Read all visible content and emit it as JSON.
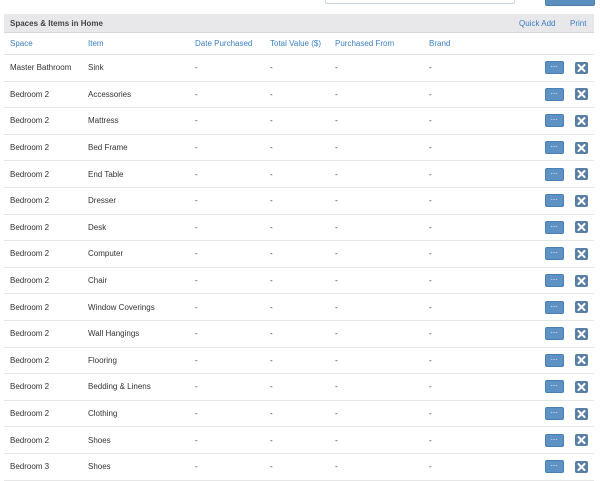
{
  "panel": {
    "title": "Spaces & Items in Home",
    "quick_add": "Quick Add",
    "print": "Print"
  },
  "columns": [
    "Space",
    "Item",
    "Date Purchased",
    "Total Value ($)",
    "Purchased From",
    "Brand"
  ],
  "rows": [
    {
      "space": "Master Bathroom",
      "item": "Sink",
      "date": "-",
      "value": "-",
      "from": "-",
      "brand": "-"
    },
    {
      "space": "Bedroom 2",
      "item": "Accessories",
      "date": "-",
      "value": "-",
      "from": "-",
      "brand": "-"
    },
    {
      "space": "Bedroom 2",
      "item": "Mattress",
      "date": "-",
      "value": "-",
      "from": "-",
      "brand": "-"
    },
    {
      "space": "Bedroom 2",
      "item": "Bed Frame",
      "date": "-",
      "value": "-",
      "from": "-",
      "brand": "-"
    },
    {
      "space": "Bedroom 2",
      "item": "End Table",
      "date": "-",
      "value": "-",
      "from": "-",
      "brand": "-"
    },
    {
      "space": "Bedroom 2",
      "item": "Dresser",
      "date": "-",
      "value": "-",
      "from": "-",
      "brand": "-"
    },
    {
      "space": "Bedroom 2",
      "item": "Desk",
      "date": "-",
      "value": "-",
      "from": "-",
      "brand": "-"
    },
    {
      "space": "Bedroom 2",
      "item": "Computer",
      "date": "-",
      "value": "-",
      "from": "-",
      "brand": "-"
    },
    {
      "space": "Bedroom 2",
      "item": "Chair",
      "date": "-",
      "value": "-",
      "from": "-",
      "brand": "-"
    },
    {
      "space": "Bedroom 2",
      "item": "Window Coverings",
      "date": "-",
      "value": "-",
      "from": "-",
      "brand": "-"
    },
    {
      "space": "Bedroom 2",
      "item": "Wall Hangings",
      "date": "-",
      "value": "-",
      "from": "-",
      "brand": "-"
    },
    {
      "space": "Bedroom 2",
      "item": "Flooring",
      "date": "-",
      "value": "-",
      "from": "-",
      "brand": "-"
    },
    {
      "space": "Bedroom 2",
      "item": "Bedding & Linens",
      "date": "-",
      "value": "-",
      "from": "-",
      "brand": "-"
    },
    {
      "space": "Bedroom 2",
      "item": "Clothing",
      "date": "-",
      "value": "-",
      "from": "-",
      "brand": "-"
    },
    {
      "space": "Bedroom 2",
      "item": "Shoes",
      "date": "-",
      "value": "-",
      "from": "-",
      "brand": "-"
    },
    {
      "space": "Bedroom 3",
      "item": "Shoes",
      "date": "-",
      "value": "-",
      "from": "-",
      "brand": "-"
    }
  ],
  "row_actions": {
    "edit_icon": "ellipsis-icon",
    "delete_icon": "close-icon",
    "edit_label": "..."
  },
  "colors": {
    "link": "#3a7fc3",
    "button": "#5e92c4",
    "delete_button": "#5a7fa6",
    "header_bg": "#e8e8ea"
  }
}
